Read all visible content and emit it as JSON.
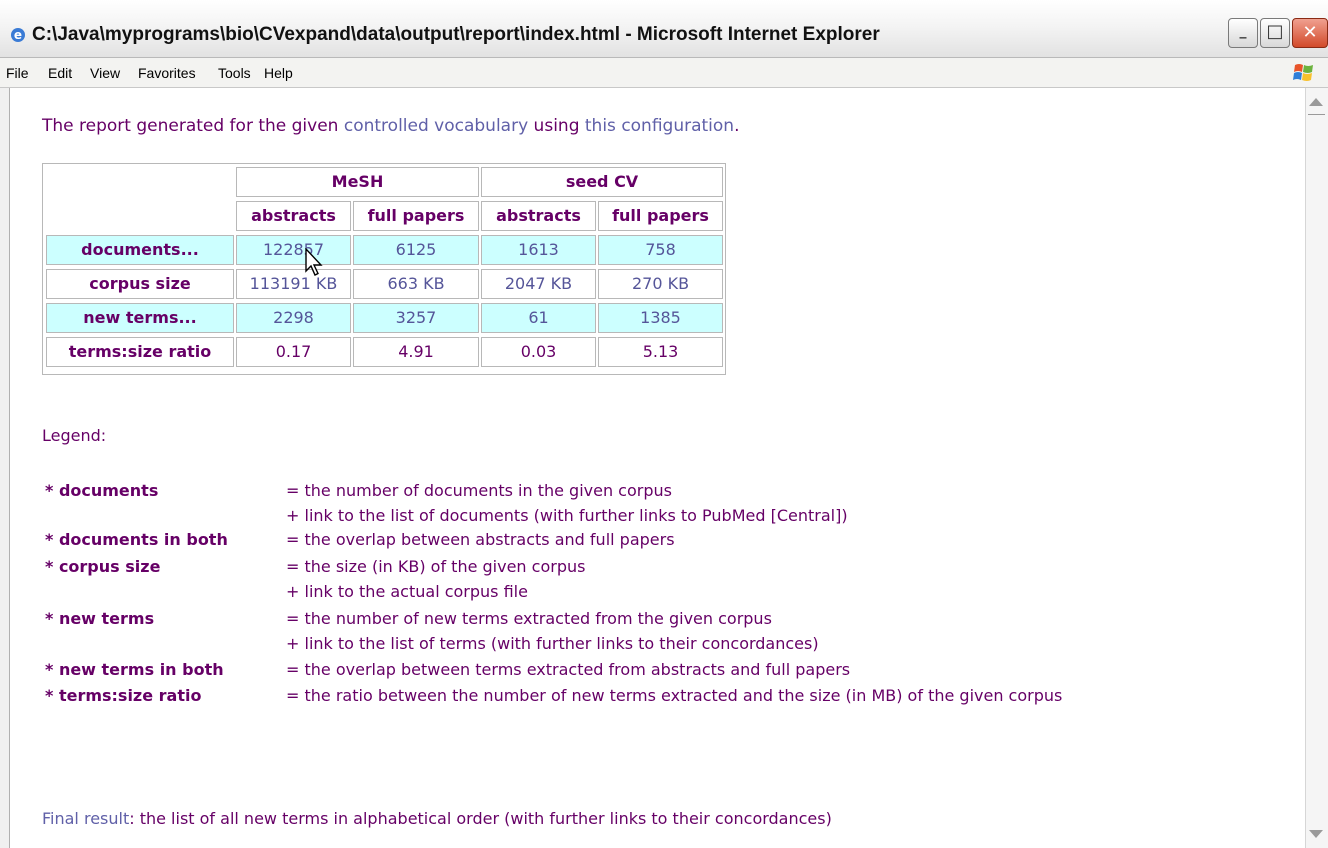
{
  "window": {
    "title": "C:\\Java\\myprograms\\bio\\CVexpand\\data\\output\\report\\index.html - Microsoft Internet Explorer",
    "minimize": "_",
    "maximize": "□",
    "close": "✕"
  },
  "menu": [
    "File",
    "Edit",
    "View",
    "Favorites",
    "Tools",
    "Help"
  ],
  "intro": {
    "prefix": "The report generated for the given ",
    "link1": "controlled vocabulary",
    "middle": " using ",
    "link2": "this configuration",
    "suffix": "."
  },
  "table": {
    "groups": [
      "MeSH",
      "seed CV"
    ],
    "subheaders": [
      "abstracts",
      "full papers",
      "abstracts",
      "full papers"
    ],
    "rows": [
      {
        "label": "documents...",
        "values": [
          "122857",
          "6125",
          "1613",
          "758"
        ]
      },
      {
        "label": "corpus size",
        "values": [
          "113191 KB",
          "663 KB",
          "2047 KB",
          "270 KB"
        ]
      },
      {
        "label": "new terms...",
        "values": [
          "2298",
          "3257",
          "61",
          "1385"
        ]
      },
      {
        "label": "terms:size ratio",
        "values": [
          "0.17",
          "4.91",
          "0.03",
          "5.13"
        ]
      }
    ]
  },
  "legend": {
    "title": "Legend:",
    "items": [
      {
        "term": "* documents",
        "def": "= the number of documents in the given corpus"
      },
      {
        "term": "",
        "def": "+ link to the list of documents (with further links to PubMed [Central])"
      },
      {
        "term": "* documents in both",
        "def": "= the overlap between abstracts and full papers"
      },
      {
        "term": "* corpus size",
        "def": "= the size (in KB) of the given corpus"
      },
      {
        "term": "",
        "def": "+ link to the actual corpus file"
      },
      {
        "term": "* new terms",
        "def": "= the number of new terms extracted from the given corpus"
      },
      {
        "term": "",
        "def": "+ link to the list of terms (with further links to their concordances)"
      },
      {
        "term": "* new terms in both",
        "def": "= the overlap between terms extracted from abstracts and full papers"
      },
      {
        "term": "* terms:size ratio",
        "def": "= the ratio between the number of new terms extracted and the size (in MB) of the given corpus"
      }
    ]
  },
  "final": {
    "link": "Final result",
    "text": ": the list of all new terms in alphabetical order (with further links to their concordances)"
  },
  "colors": {
    "text": "#660066",
    "link": "#6060a8",
    "highlight_row": "#ccffff"
  }
}
